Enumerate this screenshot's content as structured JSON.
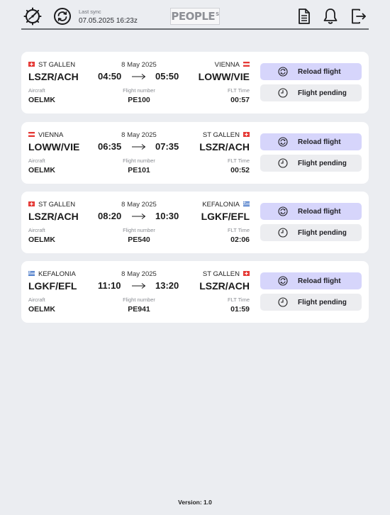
{
  "header": {
    "sync_label": "Last sync",
    "sync_value": "07.05.2025 16:23z",
    "logo_text": "PEOPLE",
    "logo_sup": "S",
    "icons": [
      "dashboard-gauge-icon",
      "sync-icon",
      "document-icon",
      "bell-icon",
      "logout-icon"
    ]
  },
  "labels": {
    "aircraft": "Aircraft",
    "flight_number": "Flight number",
    "flt_time": "FLT Time",
    "reload": "Reload flight",
    "pending": "Flight pending"
  },
  "flights": [
    {
      "dep_city": "ST GALLEN",
      "dep_flag": "ch",
      "dep_code": "LSZR/ACH",
      "date": "8 May 2025",
      "arr_city": "VIENNA",
      "arr_flag": "at",
      "arr_code": "LOWW/VIE",
      "dep_time": "04:50",
      "arr_time": "05:50",
      "aircraft": "OELMK",
      "flight_number": "PE100",
      "flt_time": "00:57"
    },
    {
      "dep_city": "VIENNA",
      "dep_flag": "at",
      "dep_code": "LOWW/VIE",
      "date": "8 May 2025",
      "arr_city": "ST GALLEN",
      "arr_flag": "ch",
      "arr_code": "LSZR/ACH",
      "dep_time": "06:35",
      "arr_time": "07:35",
      "aircraft": "OELMK",
      "flight_number": "PE101",
      "flt_time": "00:52"
    },
    {
      "dep_city": "ST GALLEN",
      "dep_flag": "ch",
      "dep_code": "LSZR/ACH",
      "date": "8 May 2025",
      "arr_city": "KEFALONIA",
      "arr_flag": "gr",
      "arr_code": "LGKF/EFL",
      "dep_time": "08:20",
      "arr_time": "10:30",
      "aircraft": "OELMK",
      "flight_number": "PE540",
      "flt_time": "02:06"
    },
    {
      "dep_city": "KEFALONIA",
      "dep_flag": "gr",
      "dep_code": "LGKF/EFL",
      "date": "8 May 2025",
      "arr_city": "ST GALLEN",
      "arr_flag": "ch",
      "arr_code": "LSZR/ACH",
      "dep_time": "11:10",
      "arr_time": "13:20",
      "aircraft": "OELMK",
      "flight_number": "PE941",
      "flt_time": "01:59"
    }
  ],
  "footer": {
    "version": "Version: 1.0"
  },
  "colors": {
    "background": "#ebedf1",
    "reload_button": "#d6d5fb",
    "pending_button": "#ecedf0",
    "card": "#ffffff"
  }
}
